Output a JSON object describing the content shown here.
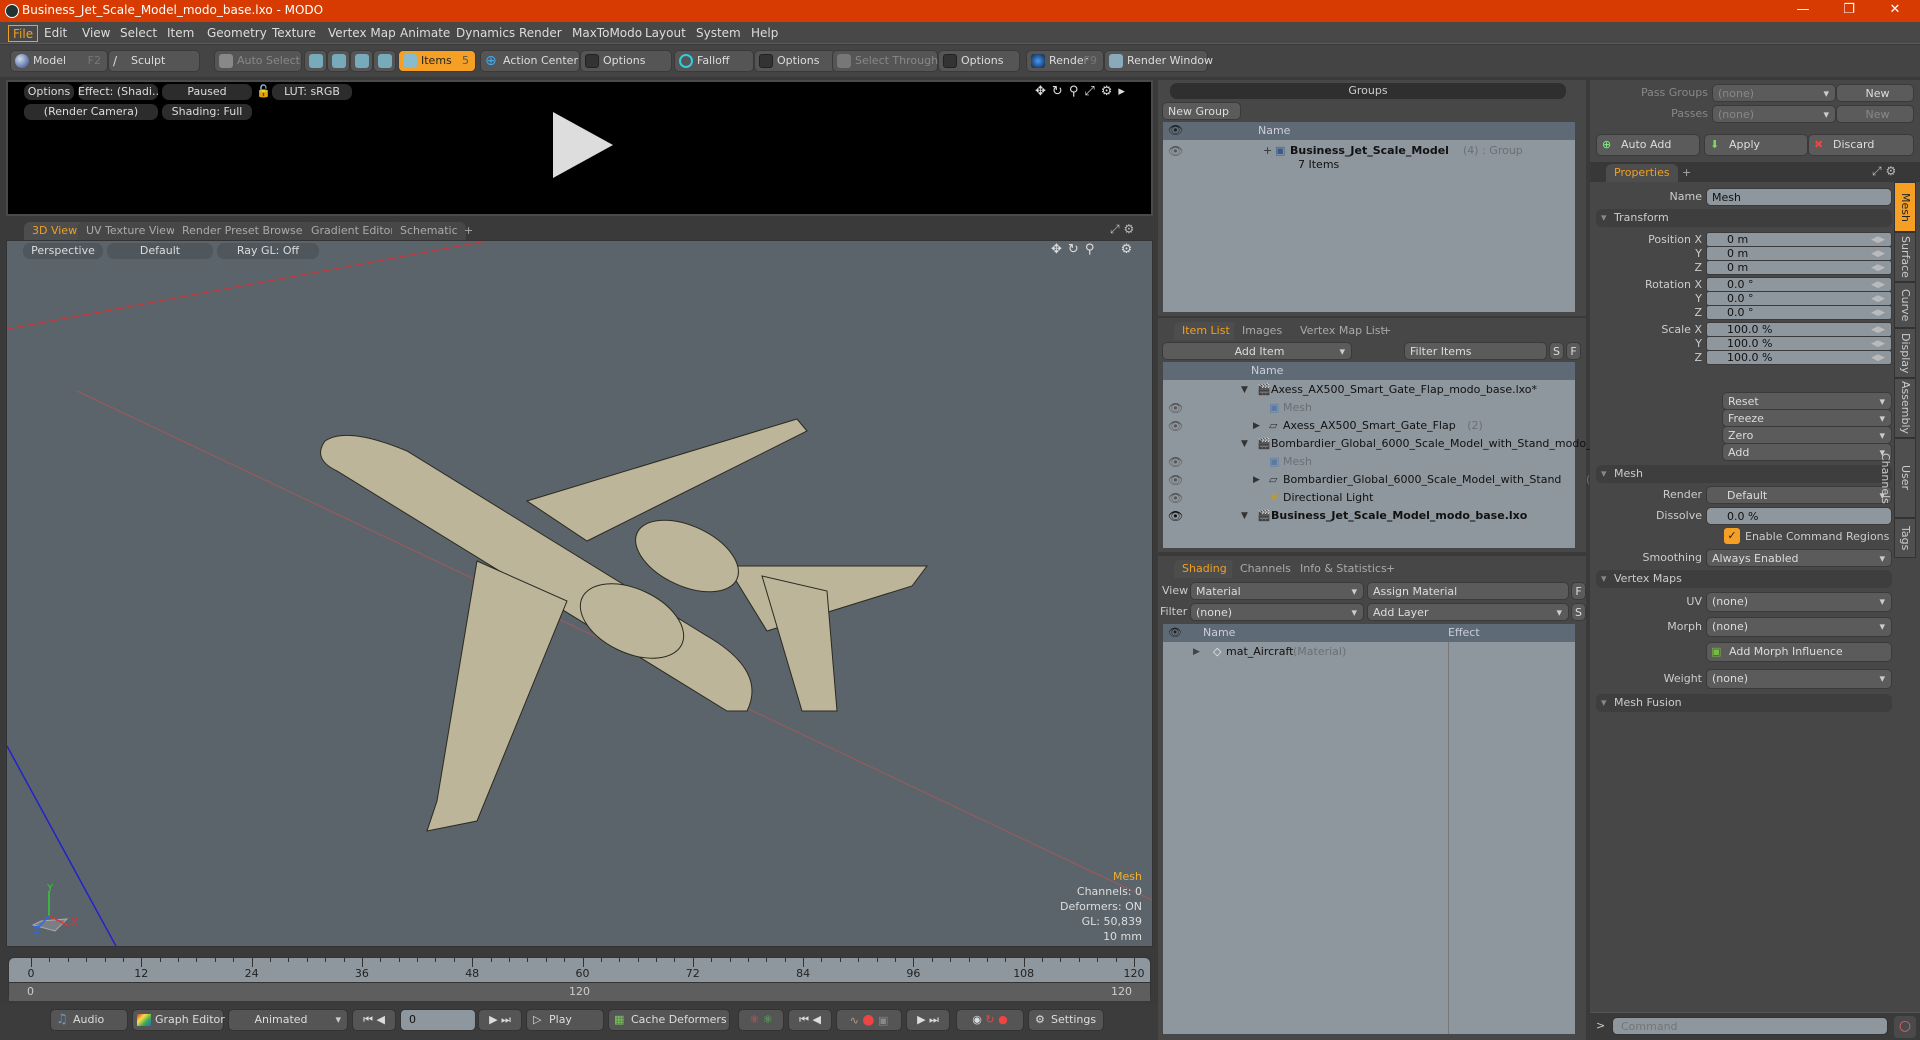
{
  "window": {
    "title": "Business_Jet_Scale_Model_modo_base.lxo - MODO",
    "minimize": "—",
    "maximize": "❐",
    "close": "✕"
  },
  "menu": [
    "File",
    "Edit",
    "View",
    "Select",
    "Item",
    "Geometry",
    "Texture",
    "Vertex Map",
    "Animate",
    "Dynamics",
    "Render",
    "MaxToModo",
    "Layout",
    "System",
    "Help"
  ],
  "toolbar": {
    "model": "Model",
    "model_key": "F2",
    "sculpt": "Sculpt",
    "auto_select": "Auto Select",
    "items": "Items",
    "items_key": "5",
    "action_center": "Action Center",
    "options1": "Options",
    "falloff": "Falloff",
    "options2": "Options",
    "select_through": "Select Through",
    "options3": "Options",
    "render": "Render",
    "render_key": "F9",
    "render_window": "Render Window"
  },
  "render_preview": {
    "options": "Options",
    "effect": "Effect: (Shadi…",
    "paused": "Paused",
    "lut": "LUT: sRGB",
    "camera": "(Render Camera)",
    "shading": "Shading: Full"
  },
  "viewport_tabs": [
    "3D View",
    "UV Texture View",
    "Render Preset Browser",
    "Gradient Editor",
    "Schematic",
    "+"
  ],
  "viewport": {
    "projection": "Perspective",
    "style": "Default",
    "raygl": "Ray GL: Off",
    "axis_labels": {
      "x": "X",
      "y": "Y",
      "z": "Z"
    },
    "info": {
      "type": "Mesh",
      "channels": "Channels: 0",
      "deformers": "Deformers: ON",
      "gl": "GL: 50,839",
      "scale": "10 mm"
    }
  },
  "timeline": {
    "ticks": [
      "0",
      "12",
      "24",
      "36",
      "48",
      "60",
      "72",
      "84",
      "96",
      "108",
      "120"
    ],
    "range_start": "0",
    "range_mid": "120",
    "range_end": "120"
  },
  "transport": {
    "audio": "Audio",
    "graph_editor": "Graph Editor",
    "mode": "Animated",
    "frame": "0",
    "play": "Play",
    "cache": "Cache Deformers",
    "settings": "Settings"
  },
  "groups": {
    "title": "Groups",
    "new_group": "New Group",
    "col_name": "Name",
    "rows": [
      {
        "name": "Business_Jet_Scale_Model",
        "count": "(4)",
        "type": ": Group",
        "sub": "7 Items"
      }
    ]
  },
  "item_list": {
    "tabs": [
      "Item List",
      "Images",
      "Vertex Map List",
      "+"
    ],
    "add_item": "Add Item",
    "filter": "Filter Items",
    "s": "S",
    "f": "F",
    "col_name": "Name",
    "rows": [
      {
        "name": "Axess_AX500_Smart_Gate_Flap_modo_base.lxo*",
        "count": "",
        "kind": "scene",
        "indent": 0,
        "eye": false,
        "bold": false,
        "dim": false
      },
      {
        "name": "Mesh",
        "count": "",
        "kind": "mesh",
        "indent": 1,
        "eye": true,
        "bold": false,
        "dim": true
      },
      {
        "name": "Axess_AX500_Smart_Gate_Flap",
        "count": "(2)",
        "kind": "folder",
        "indent": 1,
        "eye": true,
        "bold": false,
        "dim": false
      },
      {
        "name": "Bombardier_Global_6000_Scale_Model_with_Stand_modo_…",
        "count": "",
        "kind": "scene",
        "indent": 0,
        "eye": false,
        "bold": false,
        "dim": false
      },
      {
        "name": "Mesh",
        "count": "",
        "kind": "mesh",
        "indent": 1,
        "eye": true,
        "bold": false,
        "dim": true
      },
      {
        "name": "Bombardier_Global_6000_Scale_Model_with_Stand",
        "count": "(2)",
        "kind": "folder",
        "indent": 1,
        "eye": true,
        "bold": false,
        "dim": false
      },
      {
        "name": "Directional Light",
        "count": "",
        "kind": "light",
        "indent": 1,
        "eye": true,
        "bold": false,
        "dim": false
      },
      {
        "name": "Business_Jet_Scale_Model_modo_base.lxo",
        "count": "",
        "kind": "scene",
        "indent": 0,
        "eye": true,
        "bold": true,
        "dim": false
      }
    ]
  },
  "shading": {
    "tabs": [
      "Shading",
      "Channels",
      "Info & Statistics",
      "+"
    ],
    "view_label": "View",
    "view_value": "Material",
    "assign": "Assign Material",
    "f": "F",
    "filter_label": "Filter",
    "filter_value": "(none)",
    "add_layer": "Add Layer",
    "s": "S",
    "col_name": "Name",
    "col_effect": "Effect",
    "rows": [
      {
        "name": "mat_Aircraft",
        "type": "(Material)"
      }
    ]
  },
  "passes": {
    "pass_groups_label": "Pass Groups",
    "pass_groups_value": "(none)",
    "new1": "New",
    "passes_label": "Passes",
    "passes_value": "(none)",
    "new2": "New",
    "auto_add": "Auto Add",
    "apply": "Apply",
    "discard": "Discard"
  },
  "properties": {
    "tab": "Properties",
    "plus": "+",
    "name_label": "Name",
    "name_value": "Mesh",
    "transform": "Transform",
    "position": [
      {
        "label": "Position X",
        "value": "0 m"
      },
      {
        "label": "Y",
        "value": "0 m"
      },
      {
        "label": "Z",
        "value": "0 m"
      }
    ],
    "rotation": [
      {
        "label": "Rotation X",
        "value": "0.0 °"
      },
      {
        "label": "Y",
        "value": "0.0 °"
      },
      {
        "label": "Z",
        "value": "0.0 °"
      }
    ],
    "scale": [
      {
        "label": "Scale X",
        "value": "100.0 %"
      },
      {
        "label": "Y",
        "value": "100.0 %"
      },
      {
        "label": "Z",
        "value": "100.0 %"
      }
    ],
    "actions": [
      "Reset",
      "Freeze",
      "Zero",
      "Add"
    ],
    "mesh": "Mesh",
    "render_label": "Render",
    "render_value": "Default",
    "dissolve_label": "Dissolve",
    "dissolve_value": "0.0 %",
    "command_regions": "Enable Command Regions",
    "smoothing_label": "Smoothing",
    "smoothing_value": "Always Enabled",
    "vertex_maps": "Vertex Maps",
    "uv_label": "UV",
    "uv_value": "(none)",
    "morph_label": "Morph",
    "morph_value": "(none)",
    "add_morph": "Add Morph Influence",
    "weight_label": "Weight",
    "weight_value": "(none)",
    "mesh_fusion": "Mesh Fusion",
    "side_tabs": [
      "Mesh",
      "Surface",
      "Curve",
      "Display",
      "Assembly",
      "User Channels",
      "Tags"
    ]
  },
  "command": {
    "prompt": ">",
    "placeholder": "Command"
  }
}
